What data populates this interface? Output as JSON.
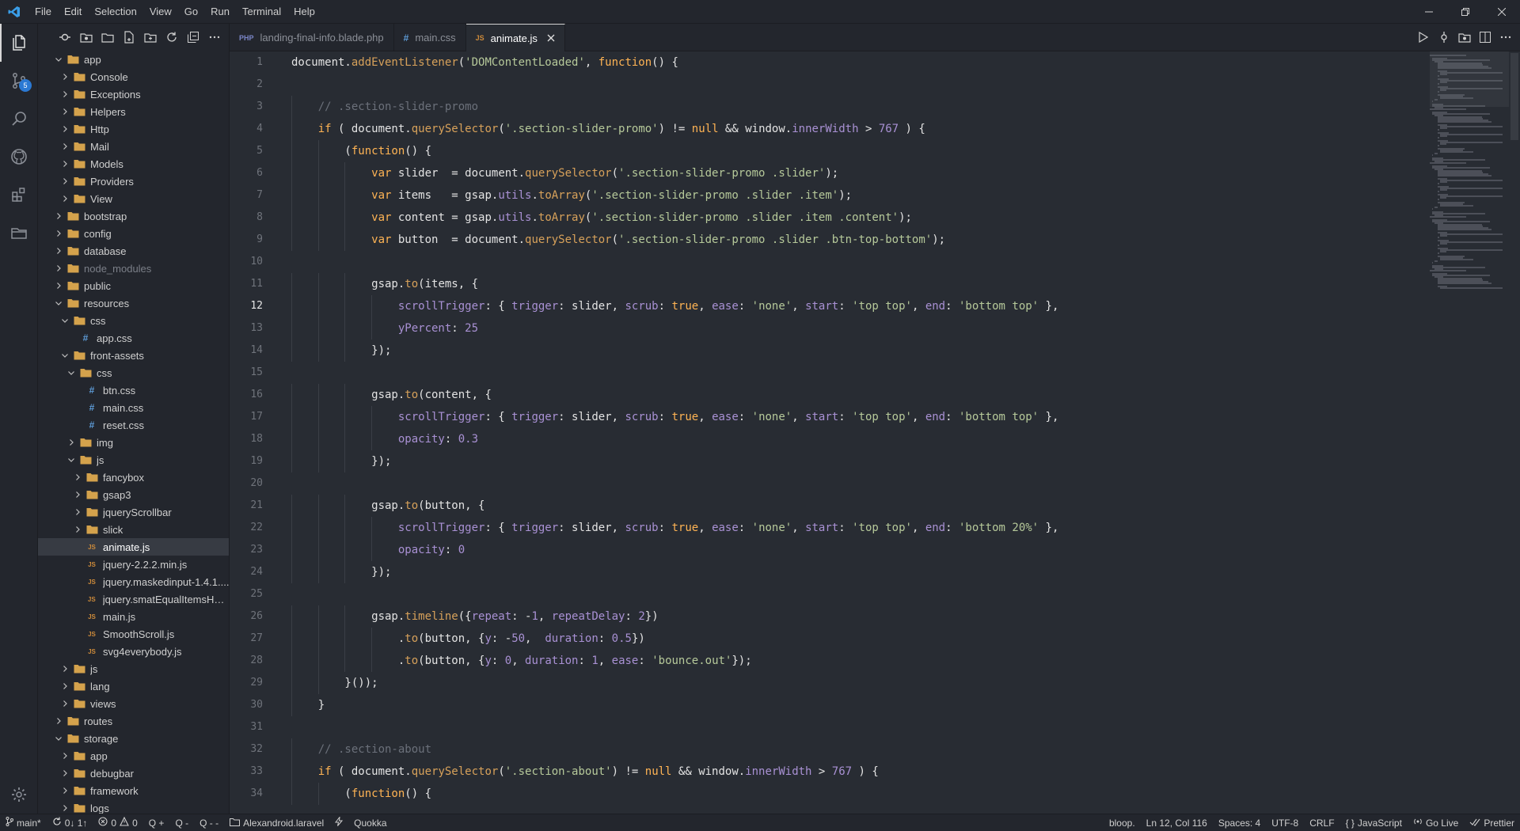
{
  "menu": [
    "File",
    "Edit",
    "Selection",
    "View",
    "Go",
    "Run",
    "Terminal",
    "Help"
  ],
  "colors": {
    "accent": "#2b79d3",
    "folder": "#d4a24c",
    "js_icon": "#cc8a3a",
    "css_icon": "#5d9bd6",
    "php_icon": "#7b86c7"
  },
  "activity": {
    "scm_badge": "5"
  },
  "tabs": [
    {
      "icon": "PHP",
      "label": "landing-final-info.blade.php",
      "active": false
    },
    {
      "icon": "#",
      "label": "main.css",
      "active": false
    },
    {
      "icon": "JS",
      "label": "animate.js",
      "active": true
    }
  ],
  "tree": [
    {
      "label": "app",
      "depth": 0,
      "type": "folder",
      "open": true
    },
    {
      "label": "Console",
      "depth": 1,
      "type": "folder",
      "open": false
    },
    {
      "label": "Exceptions",
      "depth": 1,
      "type": "folder",
      "open": false
    },
    {
      "label": "Helpers",
      "depth": 1,
      "type": "folder",
      "open": false
    },
    {
      "label": "Http",
      "depth": 1,
      "type": "folder",
      "open": false
    },
    {
      "label": "Mail",
      "depth": 1,
      "type": "folder",
      "open": false
    },
    {
      "label": "Models",
      "depth": 1,
      "type": "folder",
      "open": false
    },
    {
      "label": "Providers",
      "depth": 1,
      "type": "folder",
      "open": false
    },
    {
      "label": "View",
      "depth": 1,
      "type": "folder",
      "open": false
    },
    {
      "label": "bootstrap",
      "depth": 0,
      "type": "folder",
      "open": false
    },
    {
      "label": "config",
      "depth": 0,
      "type": "folder",
      "open": false
    },
    {
      "label": "database",
      "depth": 0,
      "type": "folder",
      "open": false
    },
    {
      "label": "node_modules",
      "depth": 0,
      "type": "folder",
      "open": false,
      "dim": true
    },
    {
      "label": "public",
      "depth": 0,
      "type": "folder",
      "open": false
    },
    {
      "label": "resources",
      "depth": 0,
      "type": "folder",
      "open": true
    },
    {
      "label": "css",
      "depth": 1,
      "type": "folder",
      "open": true
    },
    {
      "label": "app.css",
      "depth": 2,
      "type": "css"
    },
    {
      "label": "front-assets",
      "depth": 1,
      "type": "folder",
      "open": true
    },
    {
      "label": "css",
      "depth": 2,
      "type": "folder",
      "open": true
    },
    {
      "label": "btn.css",
      "depth": 3,
      "type": "css"
    },
    {
      "label": "main.css",
      "depth": 3,
      "type": "css"
    },
    {
      "label": "reset.css",
      "depth": 3,
      "type": "css"
    },
    {
      "label": "img",
      "depth": 2,
      "type": "folder",
      "open": false
    },
    {
      "label": "js",
      "depth": 2,
      "type": "folder",
      "open": true
    },
    {
      "label": "fancybox",
      "depth": 3,
      "type": "folder",
      "open": false
    },
    {
      "label": "gsap3",
      "depth": 3,
      "type": "folder",
      "open": false
    },
    {
      "label": "jqueryScrollbar",
      "depth": 3,
      "type": "folder",
      "open": false
    },
    {
      "label": "slick",
      "depth": 3,
      "type": "folder",
      "open": false
    },
    {
      "label": "animate.js",
      "depth": 3,
      "type": "js",
      "selected": true
    },
    {
      "label": "jquery-2.2.2.min.js",
      "depth": 3,
      "type": "js"
    },
    {
      "label": "jquery.maskedinput-1.4.1....",
      "depth": 3,
      "type": "js"
    },
    {
      "label": "jquery.smatEqualItemsHei...",
      "depth": 3,
      "type": "js"
    },
    {
      "label": "main.js",
      "depth": 3,
      "type": "js"
    },
    {
      "label": "SmoothScroll.js",
      "depth": 3,
      "type": "js"
    },
    {
      "label": "svg4everybody.js",
      "depth": 3,
      "type": "js"
    },
    {
      "label": "js",
      "depth": 1,
      "type": "folder",
      "open": false
    },
    {
      "label": "lang",
      "depth": 1,
      "type": "folder",
      "open": false
    },
    {
      "label": "views",
      "depth": 1,
      "type": "folder",
      "open": false
    },
    {
      "label": "routes",
      "depth": 0,
      "type": "folder",
      "open": false
    },
    {
      "label": "storage",
      "depth": 0,
      "type": "folder",
      "open": true
    },
    {
      "label": "app",
      "depth": 1,
      "type": "folder",
      "open": false
    },
    {
      "label": "debugbar",
      "depth": 1,
      "type": "folder",
      "open": false
    },
    {
      "label": "framework",
      "depth": 1,
      "type": "folder",
      "open": false
    },
    {
      "label": "logs",
      "depth": 1,
      "type": "folder",
      "open": false
    }
  ],
  "editor": {
    "current_line": 12,
    "lines": [
      [
        [
          "x",
          "document."
        ],
        [
          "m",
          "addEventListener"
        ],
        [
          "x",
          "("
        ],
        [
          "s",
          "'DOMContentLoaded'"
        ],
        [
          "x",
          ", "
        ],
        [
          "kw",
          "function"
        ],
        [
          "x",
          "() {"
        ]
      ],
      [],
      [
        [
          "x",
          "    "
        ],
        [
          "c",
          "// .section-slider-promo"
        ]
      ],
      [
        [
          "x",
          "    "
        ],
        [
          "kw",
          "if"
        ],
        [
          "x",
          " ( document."
        ],
        [
          "m",
          "querySelector"
        ],
        [
          "x",
          "("
        ],
        [
          "s",
          "'.section-slider-promo'"
        ],
        [
          "x",
          ") != "
        ],
        [
          "kw",
          "null"
        ],
        [
          "x",
          " && window."
        ],
        [
          "p",
          "innerWidth"
        ],
        [
          "x",
          " > "
        ],
        [
          "n",
          "767"
        ],
        [
          "x",
          " ) {"
        ]
      ],
      [
        [
          "x",
          "        ("
        ],
        [
          "kw",
          "function"
        ],
        [
          "x",
          "() {"
        ]
      ],
      [
        [
          "x",
          "            "
        ],
        [
          "kw",
          "var"
        ],
        [
          "x",
          " slider  = document."
        ],
        [
          "m",
          "querySelector"
        ],
        [
          "x",
          "("
        ],
        [
          "s",
          "'.section-slider-promo .slider'"
        ],
        [
          "x",
          ");"
        ]
      ],
      [
        [
          "x",
          "            "
        ],
        [
          "kw",
          "var"
        ],
        [
          "x",
          " items   = gsap."
        ],
        [
          "p",
          "utils"
        ],
        [
          "x",
          "."
        ],
        [
          "m",
          "toArray"
        ],
        [
          "x",
          "("
        ],
        [
          "s",
          "'.section-slider-promo .slider .item'"
        ],
        [
          "x",
          ");"
        ]
      ],
      [
        [
          "x",
          "            "
        ],
        [
          "kw",
          "var"
        ],
        [
          "x",
          " content = gsap."
        ],
        [
          "p",
          "utils"
        ],
        [
          "x",
          "."
        ],
        [
          "m",
          "toArray"
        ],
        [
          "x",
          "("
        ],
        [
          "s",
          "'.section-slider-promo .slider .item .content'"
        ],
        [
          "x",
          ");"
        ]
      ],
      [
        [
          "x",
          "            "
        ],
        [
          "kw",
          "var"
        ],
        [
          "x",
          " button  = document."
        ],
        [
          "m",
          "querySelector"
        ],
        [
          "x",
          "("
        ],
        [
          "s",
          "'.section-slider-promo .slider .btn-top-bottom'"
        ],
        [
          "x",
          ");"
        ]
      ],
      [],
      [
        [
          "x",
          "            gsap."
        ],
        [
          "m",
          "to"
        ],
        [
          "x",
          "(items, {"
        ]
      ],
      [
        [
          "x",
          "                "
        ],
        [
          "p",
          "scrollTrigger"
        ],
        [
          "x",
          ": { "
        ],
        [
          "p",
          "trigger"
        ],
        [
          "x",
          ": slider, "
        ],
        [
          "p",
          "scrub"
        ],
        [
          "x",
          ": "
        ],
        [
          "kw",
          "true"
        ],
        [
          "x",
          ", "
        ],
        [
          "p",
          "ease"
        ],
        [
          "x",
          ": "
        ],
        [
          "s",
          "'none'"
        ],
        [
          "x",
          ", "
        ],
        [
          "p",
          "start"
        ],
        [
          "x",
          ": "
        ],
        [
          "s",
          "'top top'"
        ],
        [
          "x",
          ", "
        ],
        [
          "p",
          "end"
        ],
        [
          "x",
          ": "
        ],
        [
          "s",
          "'bottom top'"
        ],
        [
          "x",
          " },"
        ]
      ],
      [
        [
          "x",
          "                "
        ],
        [
          "p",
          "yPercent"
        ],
        [
          "x",
          ": "
        ],
        [
          "n",
          "25"
        ]
      ],
      [
        [
          "x",
          "            });"
        ]
      ],
      [],
      [
        [
          "x",
          "            gsap."
        ],
        [
          "m",
          "to"
        ],
        [
          "x",
          "(content, {"
        ]
      ],
      [
        [
          "x",
          "                "
        ],
        [
          "p",
          "scrollTrigger"
        ],
        [
          "x",
          ": { "
        ],
        [
          "p",
          "trigger"
        ],
        [
          "x",
          ": slider, "
        ],
        [
          "p",
          "scrub"
        ],
        [
          "x",
          ": "
        ],
        [
          "kw",
          "true"
        ],
        [
          "x",
          ", "
        ],
        [
          "p",
          "ease"
        ],
        [
          "x",
          ": "
        ],
        [
          "s",
          "'none'"
        ],
        [
          "x",
          ", "
        ],
        [
          "p",
          "start"
        ],
        [
          "x",
          ": "
        ],
        [
          "s",
          "'top top'"
        ],
        [
          "x",
          ", "
        ],
        [
          "p",
          "end"
        ],
        [
          "x",
          ": "
        ],
        [
          "s",
          "'bottom top'"
        ],
        [
          "x",
          " },"
        ]
      ],
      [
        [
          "x",
          "                "
        ],
        [
          "p",
          "opacity"
        ],
        [
          "x",
          ": "
        ],
        [
          "n",
          "0.3"
        ]
      ],
      [
        [
          "x",
          "            });"
        ]
      ],
      [],
      [
        [
          "x",
          "            gsap."
        ],
        [
          "m",
          "to"
        ],
        [
          "x",
          "(button, {"
        ]
      ],
      [
        [
          "x",
          "                "
        ],
        [
          "p",
          "scrollTrigger"
        ],
        [
          "x",
          ": { "
        ],
        [
          "p",
          "trigger"
        ],
        [
          "x",
          ": slider, "
        ],
        [
          "p",
          "scrub"
        ],
        [
          "x",
          ": "
        ],
        [
          "kw",
          "true"
        ],
        [
          "x",
          ", "
        ],
        [
          "p",
          "ease"
        ],
        [
          "x",
          ": "
        ],
        [
          "s",
          "'none'"
        ],
        [
          "x",
          ", "
        ],
        [
          "p",
          "start"
        ],
        [
          "x",
          ": "
        ],
        [
          "s",
          "'top top'"
        ],
        [
          "x",
          ", "
        ],
        [
          "p",
          "end"
        ],
        [
          "x",
          ": "
        ],
        [
          "s",
          "'bottom 20%'"
        ],
        [
          "x",
          " },"
        ]
      ],
      [
        [
          "x",
          "                "
        ],
        [
          "p",
          "opacity"
        ],
        [
          "x",
          ": "
        ],
        [
          "n",
          "0"
        ]
      ],
      [
        [
          "x",
          "            });"
        ]
      ],
      [],
      [
        [
          "x",
          "            gsap."
        ],
        [
          "m",
          "timeline"
        ],
        [
          "x",
          "({"
        ],
        [
          "p",
          "repeat"
        ],
        [
          "x",
          ": -"
        ],
        [
          "n",
          "1"
        ],
        [
          "x",
          ", "
        ],
        [
          "p",
          "repeatDelay"
        ],
        [
          "x",
          ": "
        ],
        [
          "n",
          "2"
        ],
        [
          "x",
          "})"
        ]
      ],
      [
        [
          "x",
          "                ."
        ],
        [
          "m",
          "to"
        ],
        [
          "x",
          "(button, {"
        ],
        [
          "p",
          "y"
        ],
        [
          "x",
          ": -"
        ],
        [
          "n",
          "50"
        ],
        [
          "x",
          ",  "
        ],
        [
          "p",
          "duration"
        ],
        [
          "x",
          ": "
        ],
        [
          "n",
          "0.5"
        ],
        [
          "x",
          "})"
        ]
      ],
      [
        [
          "x",
          "                ."
        ],
        [
          "m",
          "to"
        ],
        [
          "x",
          "(button, {"
        ],
        [
          "p",
          "y"
        ],
        [
          "x",
          ": "
        ],
        [
          "n",
          "0"
        ],
        [
          "x",
          ", "
        ],
        [
          "p",
          "duration"
        ],
        [
          "x",
          ": "
        ],
        [
          "n",
          "1"
        ],
        [
          "x",
          ", "
        ],
        [
          "p",
          "ease"
        ],
        [
          "x",
          ": "
        ],
        [
          "s",
          "'bounce.out'"
        ],
        [
          "x",
          "});"
        ]
      ],
      [
        [
          "x",
          "        }());"
        ]
      ],
      [
        [
          "x",
          "    }"
        ]
      ],
      [],
      [
        [
          "x",
          "    "
        ],
        [
          "c",
          "// .section-about"
        ]
      ],
      [
        [
          "x",
          "    "
        ],
        [
          "kw",
          "if"
        ],
        [
          "x",
          " ( document."
        ],
        [
          "m",
          "querySelector"
        ],
        [
          "x",
          "("
        ],
        [
          "s",
          "'.section-about'"
        ],
        [
          "x",
          ") != "
        ],
        [
          "kw",
          "null"
        ],
        [
          "x",
          " && window."
        ],
        [
          "p",
          "innerWidth"
        ],
        [
          "x",
          " > "
        ],
        [
          "n",
          "767"
        ],
        [
          "x",
          " ) {"
        ]
      ],
      [
        [
          "x",
          "        ("
        ],
        [
          "kw",
          "function"
        ],
        [
          "x",
          "() {"
        ]
      ]
    ]
  },
  "status": {
    "branch": "main*",
    "sync": "0↓ 1↑",
    "errors": "0",
    "warnings": "0",
    "q1": "Q +",
    "q2": "Q -",
    "q3": "Q - -",
    "project": "Alexandroid.laravel",
    "quokka": "Quokka",
    "bloop": "bloop.",
    "position": "Ln 12, Col 116",
    "spaces": "Spaces: 4",
    "encoding": "UTF-8",
    "eol": "CRLF",
    "language": "JavaScript",
    "golive": "Go Live",
    "prettier": "Prettier"
  }
}
